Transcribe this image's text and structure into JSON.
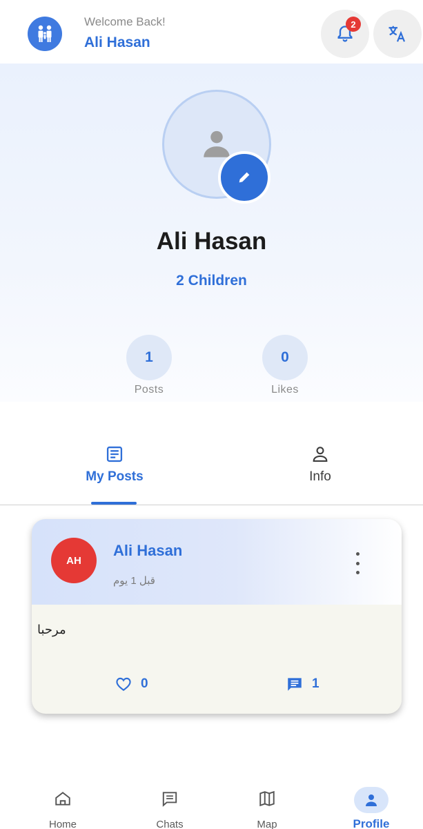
{
  "header": {
    "welcome": "Welcome Back!",
    "user_name": "Ali Hasan",
    "notification_count": "2",
    "icons": {
      "logo": "family-icon",
      "bell": "bell-icon",
      "translate": "translate-icon"
    }
  },
  "profile": {
    "name": "Ali Hasan",
    "children": "2 Children",
    "stats": [
      {
        "value": "1",
        "label": "Posts"
      },
      {
        "value": "0",
        "label": "Likes"
      }
    ]
  },
  "tabs": [
    {
      "label": "My Posts",
      "icon": "posts-icon",
      "active": true
    },
    {
      "label": "Info",
      "icon": "person-icon",
      "active": false
    }
  ],
  "post": {
    "avatar_initials": "AH",
    "author": "Ali Hasan",
    "time": "قبل 1 يوم",
    "text": "مرحبا",
    "likes": "0",
    "comments": "1"
  },
  "nav": [
    {
      "label": "Home",
      "icon": "home-icon"
    },
    {
      "label": "Chats",
      "icon": "chat-icon"
    },
    {
      "label": "Map",
      "icon": "map-icon"
    },
    {
      "label": "Profile",
      "icon": "profile-icon",
      "active": true
    }
  ],
  "colors": {
    "accent": "#2f6fd8",
    "badge": "#e53935"
  }
}
